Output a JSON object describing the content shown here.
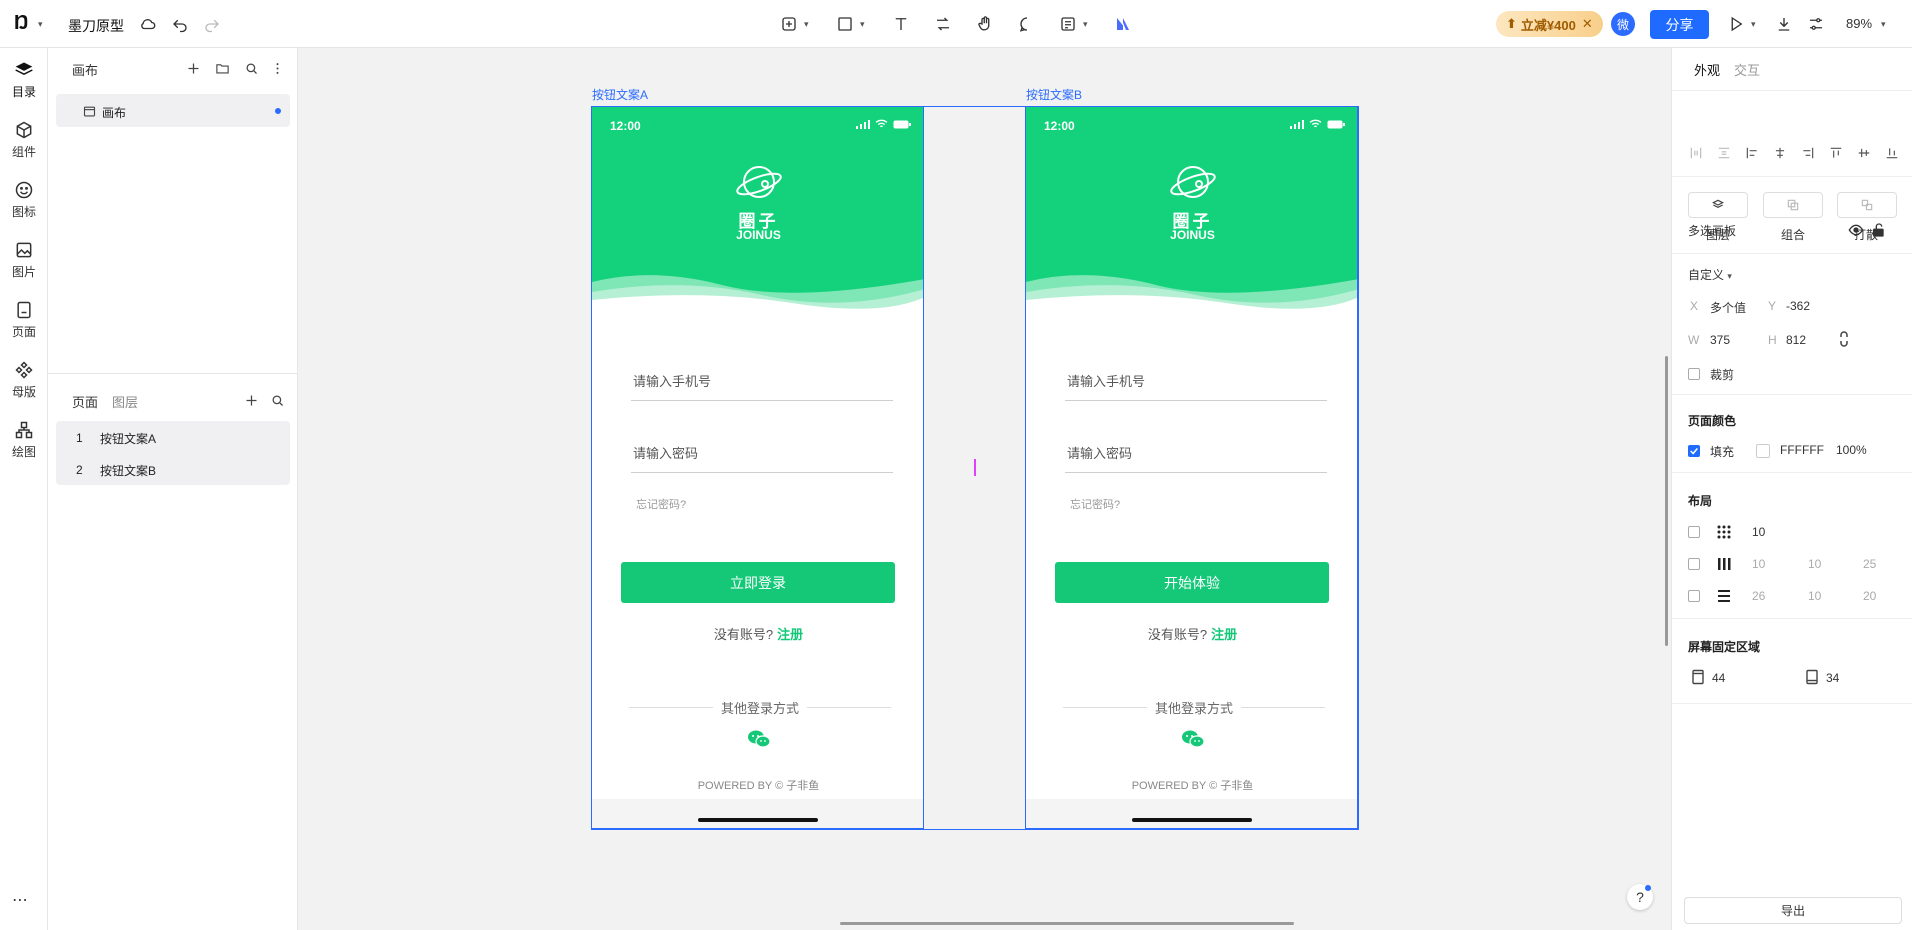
{
  "topbar": {
    "logo": "Ŋ",
    "app_name": "墨刀原型",
    "promo": "立减¥400",
    "avatar": "微",
    "share": "分享",
    "zoom": "89%"
  },
  "rail": [
    {
      "label": "目录",
      "icon": "layers-icon"
    },
    {
      "label": "组件",
      "icon": "component-icon"
    },
    {
      "label": "图标",
      "icon": "smiley-icon"
    },
    {
      "label": "图片",
      "icon": "image-icon"
    },
    {
      "label": "页面",
      "icon": "page-icon"
    },
    {
      "label": "母版",
      "icon": "master-icon"
    },
    {
      "label": "绘图",
      "icon": "draw-icon"
    }
  ],
  "rail_more": "⋯",
  "left_panel": {
    "canvas_title": "画布",
    "canvas_item": "画布",
    "pages_tab": "页面",
    "layers_tab": "图层",
    "pages": [
      {
        "num": "1",
        "name": "按钮文案A"
      },
      {
        "num": "2",
        "name": "按钮文案B"
      }
    ]
  },
  "frames": [
    {
      "label": "按钮文案A",
      "time": "12:00",
      "brand": "圈子",
      "brand_en": "JOINUS",
      "phone_placeholder": "请输入手机号",
      "password_placeholder": "请输入密码",
      "forgot": "忘记密码?",
      "button": "立即登录",
      "no_account": "没有账号?",
      "register": "注册",
      "other_login": "其他登录方式",
      "powered": "POWERED BY © 子非鱼"
    },
    {
      "label": "按钮文案B",
      "time": "12:00",
      "brand": "圈子",
      "brand_en": "JOINUS",
      "phone_placeholder": "请输入手机号",
      "password_placeholder": "请输入密码",
      "forgot": "忘记密码?",
      "button": "开始体验",
      "no_account": "没有账号?",
      "register": "注册",
      "other_login": "其他登录方式",
      "powered": "POWERED BY © 子非鱼"
    }
  ],
  "right_panel": {
    "tabs": [
      "外观",
      "交互"
    ],
    "group_buttons": [
      "图层",
      "组合",
      "打散"
    ],
    "multi_board": "多选画板",
    "custom": "自定义",
    "x_label": "X",
    "x_value": "多个值",
    "y_label": "Y",
    "y_value": "-362",
    "w_label": "W",
    "w_value": "375",
    "h_label": "H",
    "h_value": "812",
    "clip": "裁剪",
    "page_color": "页面颜色",
    "fill": "填充",
    "color_hex": "FFFFFF",
    "opacity": "100%",
    "layout": "布局",
    "grid_val": "10",
    "cols": [
      "10",
      "10",
      "25"
    ],
    "rows": [
      "26",
      "10",
      "20"
    ],
    "fixed_area": "屏幕固定区域",
    "fixed_top": "44",
    "fixed_bottom": "34",
    "export": "导出"
  },
  "help": "?"
}
